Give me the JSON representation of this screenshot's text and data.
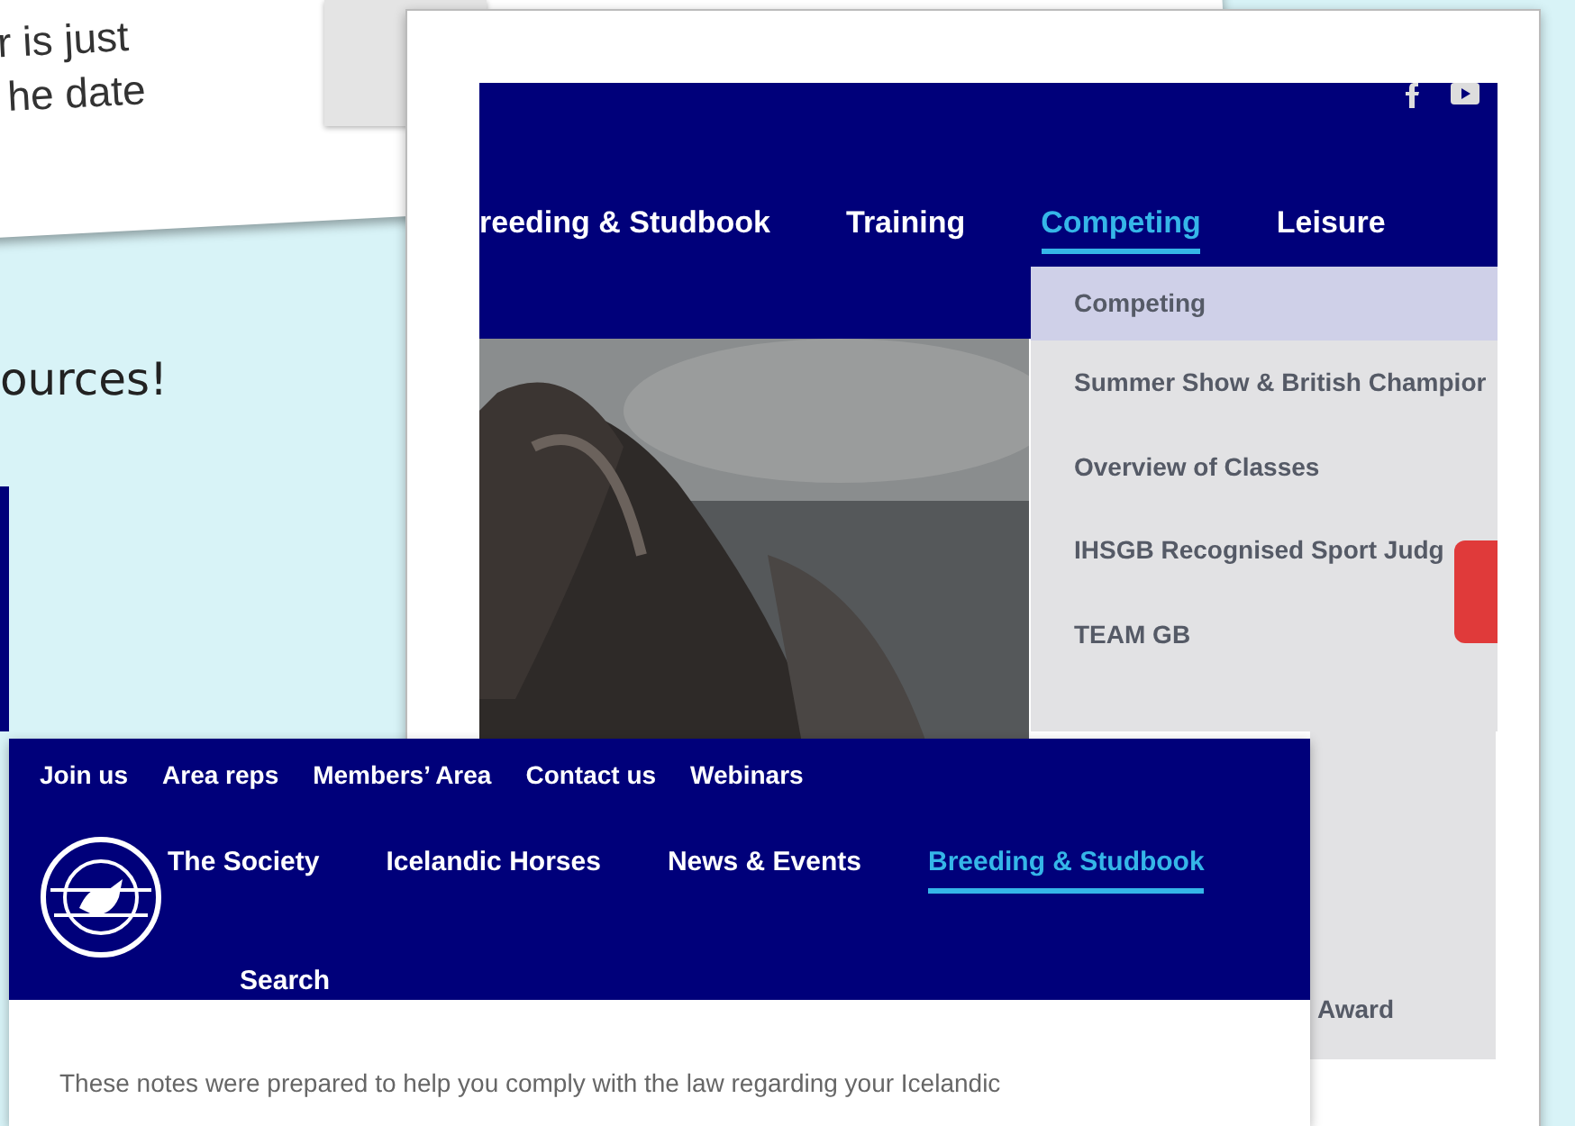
{
  "background_card": {
    "lines": [
      "r is just",
      "he date"
    ]
  },
  "slide_text": "ources!",
  "back_window": {
    "nav": [
      {
        "label": "reeding & Studbook",
        "selected": false
      },
      {
        "label": "Training",
        "selected": false
      },
      {
        "label": "Competing",
        "selected": true
      },
      {
        "label": "Leisure",
        "selected": false
      }
    ],
    "dropdown": [
      {
        "label": "Competing",
        "selected": true
      },
      {
        "label": "Summer Show & British Champior",
        "selected": false
      },
      {
        "label": "Overview of Classes",
        "selected": false
      },
      {
        "label": "IHSGB Recognised Sport Judg",
        "selected": false
      },
      {
        "label": "TEAM GB",
        "selected": false
      }
    ],
    "dropdown_last": "Award"
  },
  "front_window": {
    "top_links": [
      "Join us",
      "Area reps",
      "Members’ Area",
      "Contact us",
      "Webinars"
    ],
    "nav": [
      {
        "label": "The Society",
        "selected": false
      },
      {
        "label": "Icelandic Horses",
        "selected": false
      },
      {
        "label": "News & Events",
        "selected": false
      },
      {
        "label": "Breeding & Studbook",
        "selected": true
      }
    ],
    "search": "Search",
    "body_text": "These notes were prepared to help you comply with the law regarding your Icelandic"
  }
}
